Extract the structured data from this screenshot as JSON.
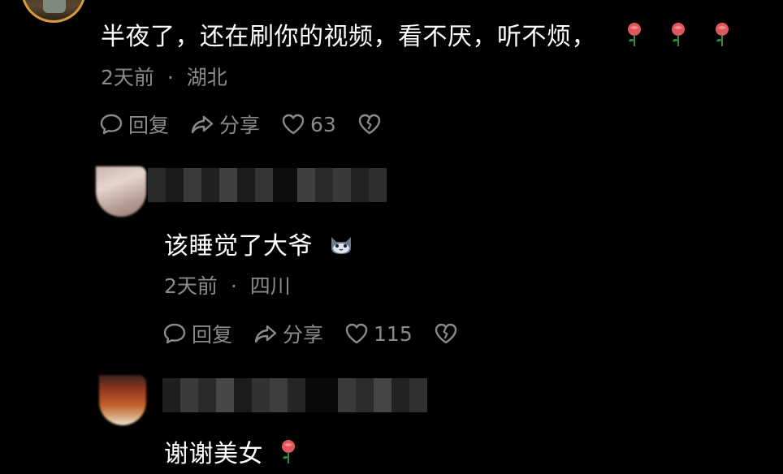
{
  "comment": {
    "text": "半夜了，还在刷你的视频，看不厌，听不烦，",
    "emojis": [
      "rose-emoji",
      "rose-emoji",
      "rose-emoji"
    ],
    "time": "2天前",
    "separator": "·",
    "location": "湖北",
    "reply_label": "回复",
    "share_label": "分享",
    "likes": "63"
  },
  "replies": [
    {
      "text": "该睡觉了大爷",
      "emoji": "cat-face-emoji",
      "time": "2天前",
      "separator": "·",
      "location": "四川",
      "reply_label": "回复",
      "share_label": "分享",
      "likes": "115"
    },
    {
      "text": "谢谢美女",
      "emoji": "rose-emoji"
    }
  ],
  "colors": {
    "background": "#000000",
    "text_primary": "#ffffff",
    "text_secondary": "#8a8a8a",
    "rose_red": "#e0575d",
    "stem_green": "#2f8a3a"
  }
}
